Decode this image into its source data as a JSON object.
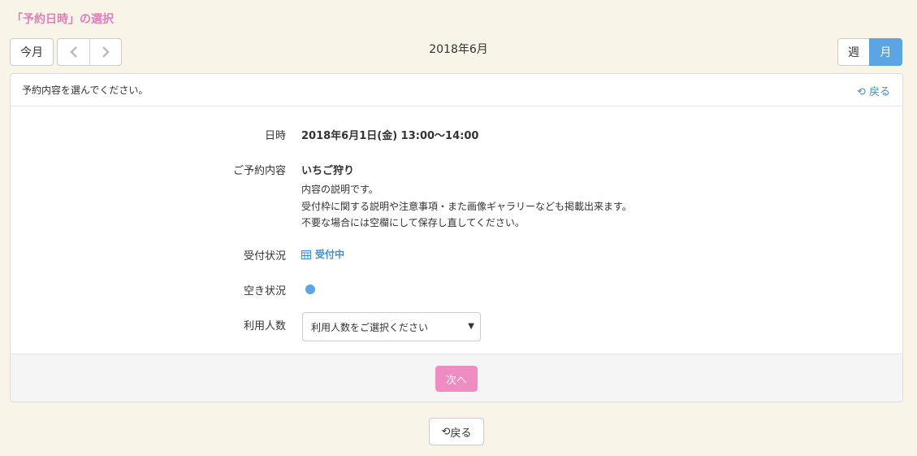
{
  "page": {
    "title": "「予約日時」の選択"
  },
  "toolbar": {
    "today_label": "今月",
    "prev_icon": "chevron-left-icon",
    "next_icon": "chevron-right-icon",
    "current_month": "2018年6月",
    "week_label": "週",
    "month_label": "月"
  },
  "panel": {
    "hint": "予約内容を選んでください。",
    "back_label": "戻る"
  },
  "details": {
    "datetime_label": "日時",
    "datetime_value": "2018年6月1日(金) 13:00〜14:00",
    "content_label": "ご予約内容",
    "content_value": "いちご狩り",
    "description": [
      "内容の説明です。",
      "受付枠に関する説明や注意事項・また画像ギャラリーなども掲載出来ます。",
      "不要な場合には空欄にして保存し直してください。"
    ],
    "reception_label": "受付状況",
    "reception_value": "受付中",
    "availability_label": "空き状況",
    "people_label": "利用人数",
    "people_select": "利用人数をご選択ください"
  },
  "footer": {
    "next_label": "次へ"
  },
  "bottom": {
    "back_label": "戻る"
  },
  "colors": {
    "accent_pink": "#ef8dc3",
    "accent_blue": "#5ba5e5",
    "title_pink": "#e37fb8"
  }
}
